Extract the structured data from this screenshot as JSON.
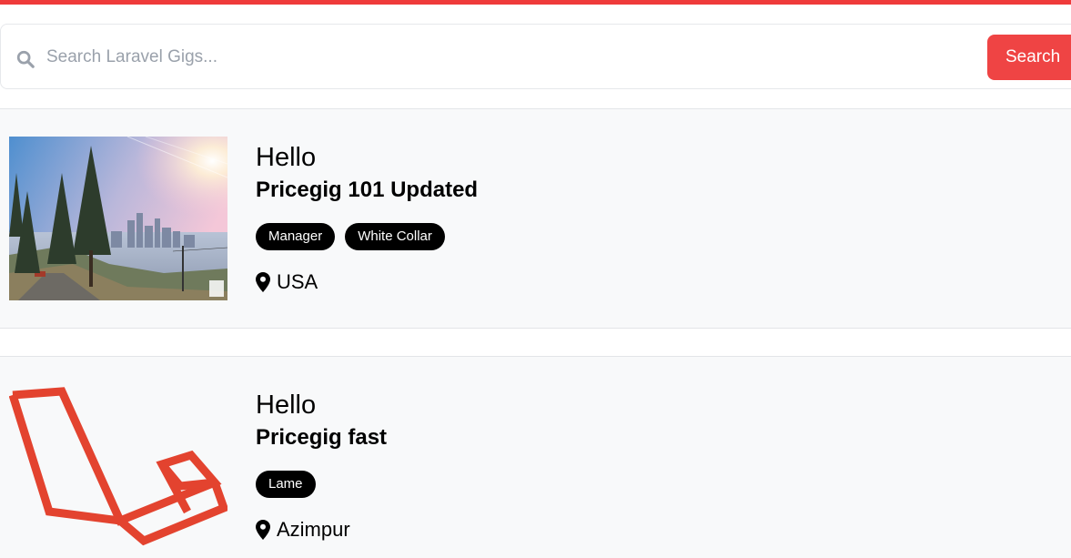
{
  "search": {
    "placeholder": "Search Laravel Gigs...",
    "button_label": "Search"
  },
  "gigs": [
    {
      "company": "Hello",
      "title": "Pricegig 101 Updated",
      "tags": [
        "Manager",
        "White Collar"
      ],
      "location": "USA",
      "image": "city-landscape-photo"
    },
    {
      "company": "Hello",
      "title": "Pricegig fast",
      "tags": [
        "Lame"
      ],
      "location": "Azimpur",
      "image": "laravel-logo"
    }
  ],
  "colors": {
    "accent": "#ef4444",
    "tag_bg": "#000000",
    "card_bg": "#f8f9fa"
  }
}
